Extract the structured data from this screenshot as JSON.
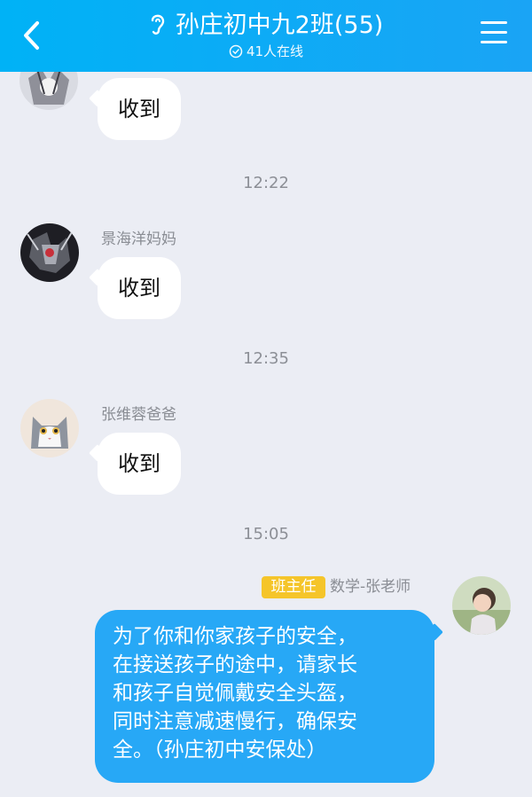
{
  "header": {
    "title": "孙庄初中九2班(55)",
    "online": "41人在线",
    "colors": {
      "accent": "#1aa4f5",
      "text": "#ffffff"
    },
    "icons": {
      "back": "back-chevron-icon",
      "listen": "ear-icon",
      "status": "check-circle-icon",
      "menu": "hamburger-menu-icon"
    }
  },
  "messages": [
    {
      "text": "收到"
    },
    {
      "time": "12:22"
    },
    {
      "sender": "景海洋妈妈",
      "text": "收到"
    },
    {
      "time": "12:35"
    },
    {
      "sender": "张维蓉爸爸",
      "text": "收到"
    },
    {
      "time": "15:05"
    },
    {
      "badge": "班主任",
      "sender": "数学-张老师",
      "lines": [
        "为了你和你家孩子的安全，",
        "在接送孩子的途中，请家长",
        "和孩子自觉佩戴安全头盔，",
        "同时注意减速慢行，确保安",
        "全。（孙庄初中安保处）"
      ]
    }
  ],
  "colors": {
    "background": "#ebedf4",
    "bubble_self": "#27a8f6",
    "badge": "#f5c52a"
  }
}
